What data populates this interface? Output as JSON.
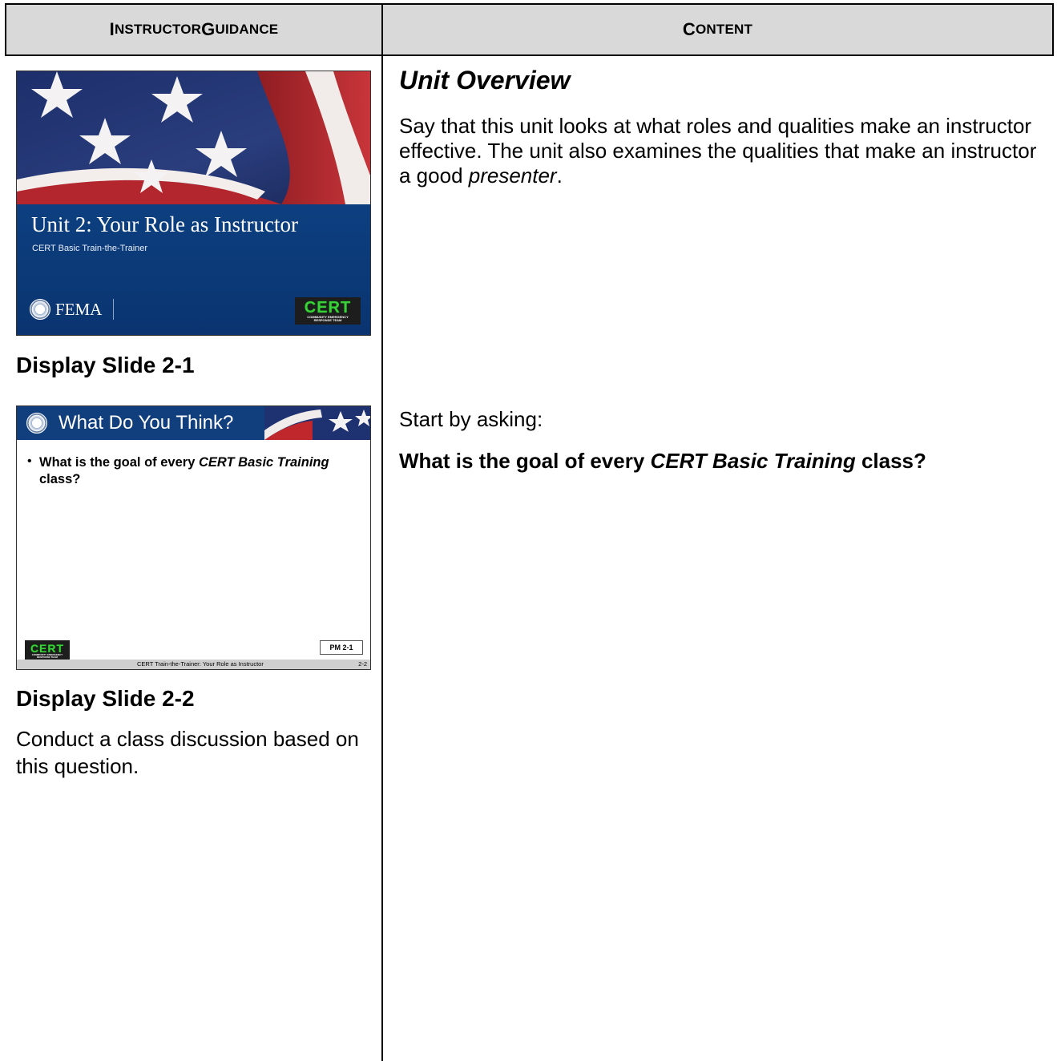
{
  "header": {
    "guidance_first": "I",
    "guidance_rest": "NSTRUCTOR ",
    "guidance_second": "G",
    "guidance_rest2": "UIDANCE",
    "content_first": "C",
    "content_rest": "ONTENT"
  },
  "slide1": {
    "title": "Unit 2: Your Role as Instructor",
    "subtitle": "CERT Basic Train-the-Trainer",
    "agency": "FEMA",
    "logo_word": "CERT",
    "logo_tag_line1": "COMMUNITY EMERGENCY",
    "logo_tag_line2": "RESPONSE TEAM",
    "caption": "Display Slide 2-1"
  },
  "slide2": {
    "title": "What Do You Think?",
    "bullet_before": "What is the goal of every ",
    "bullet_italic": "CERT Basic Training",
    "bullet_after": " class?",
    "pm_label": "PM 2-1",
    "footer_text": "CERT Train-the-Trainer: Your Role as Instructor",
    "footer_num": "2-2",
    "logo_word": "CERT",
    "logo_tag_line1": "COMMUNITY EMERGENCY",
    "logo_tag_line2": "RESPONSE TEAM",
    "caption": "Display Slide 2-2"
  },
  "guidance_note": "Conduct a class discussion based on this question.",
  "content": {
    "title": "Unit Overview",
    "para_before": "Say that this unit looks at what roles and qualities make an instructor effective. The unit also examines the qualities that make an instructor a good ",
    "para_italic": "presenter",
    "para_after": ".",
    "start": "Start by asking:",
    "question_before": "What is the goal of every ",
    "question_italic": "CERT Basic Training",
    "question_after": " class?"
  },
  "colors": {
    "header_bg": "#d9d9d9",
    "slide_blue": "#0d3f80",
    "cert_green": "#39d03a"
  }
}
